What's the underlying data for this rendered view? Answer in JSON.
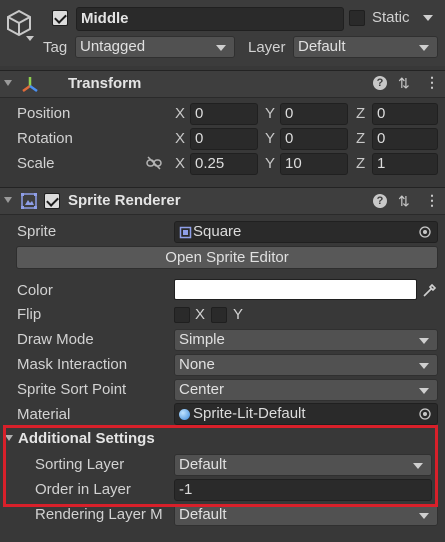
{
  "object": {
    "name": "Middle",
    "static_label": "Static",
    "tag_label": "Tag",
    "tag_value": "Untagged",
    "layer_label": "Layer",
    "layer_value": "Default"
  },
  "transform": {
    "title": "Transform",
    "position_label": "Position",
    "rotation_label": "Rotation",
    "scale_label": "Scale",
    "axes": [
      "X",
      "Y",
      "Z"
    ],
    "position": [
      "0",
      "0",
      "0"
    ],
    "rotation": [
      "0",
      "0",
      "0"
    ],
    "scale": [
      "0.25",
      "10",
      "1"
    ]
  },
  "sprite_renderer": {
    "title": "Sprite Renderer",
    "sprite_label": "Sprite",
    "sprite_value": "Square",
    "open_editor": "Open Sprite Editor",
    "color_label": "Color",
    "color_value": "#ffffff",
    "flip_label": "Flip",
    "flip_x": "X",
    "flip_y": "Y",
    "draw_mode_label": "Draw Mode",
    "draw_mode_value": "Simple",
    "mask_label": "Mask Interaction",
    "mask_value": "None",
    "sort_point_label": "Sprite Sort Point",
    "sort_point_value": "Center",
    "material_label": "Material",
    "material_value": "Sprite-Lit-Default"
  },
  "additional": {
    "title": "Additional Settings",
    "sorting_layer_label": "Sorting Layer",
    "sorting_layer_value": "Default",
    "order_label": "Order in Layer",
    "order_value": "-1",
    "rendering_label": "Rendering Layer M",
    "rendering_value": "Default"
  },
  "highlight_color": "#d8202a"
}
